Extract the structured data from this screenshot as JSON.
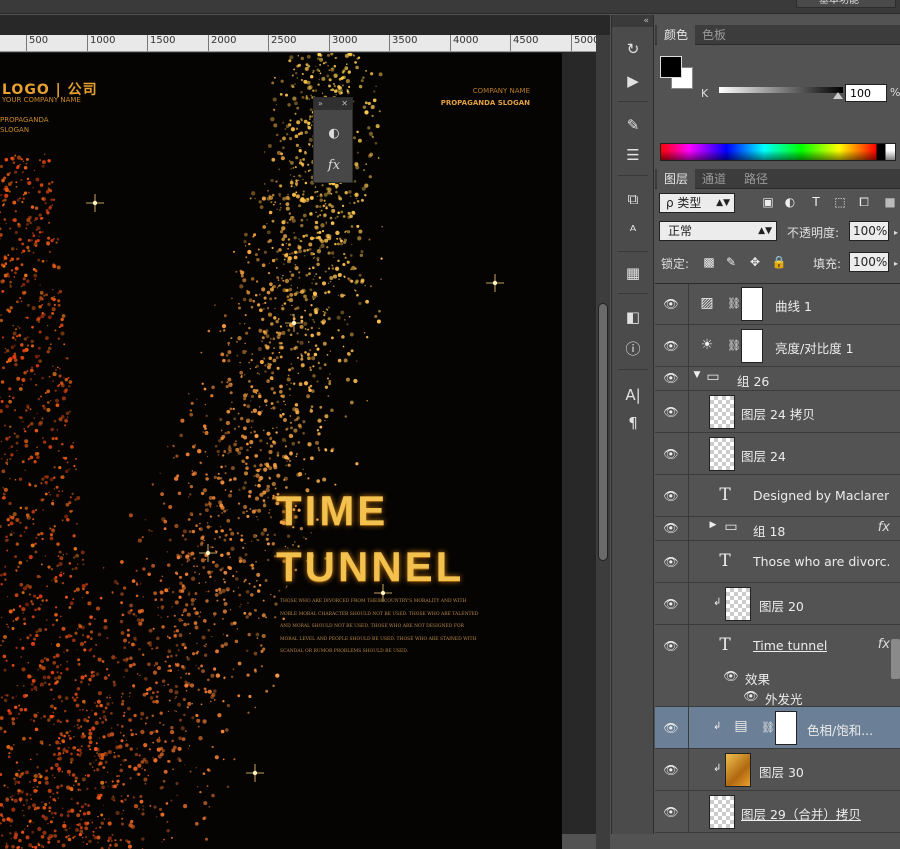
{
  "workspace_menu": "基本功能",
  "ruler": {
    "ticks": [
      "500",
      "1000",
      "1500",
      "2000",
      "2500",
      "3000",
      "3500",
      "4000",
      "4500",
      "5000"
    ]
  },
  "poster": {
    "logo": "LOGO | 公司",
    "logo_sub": "YOUR COMPANY NAME",
    "propaganda": "PROPAGANDA SLOGAN",
    "company_name": "COMPANY NAME",
    "company_slogan": "PROPAGANDA SLOGAN",
    "title_line1": "TIME",
    "title_line2": "TUNNEL",
    "body": "THOSE WHO ARE DIVORCED FROM THEIR COUNTRY'S MORALITY AND WITH NOBLE MORAL CHARACTER SHOULD NOT BE USED. THOSE WHO ARE TALENTED AND MORAL SHOULD NOT BE USED. THOSE WHO ARE NOT DESIGNED FOR MORAL LEVEL AND PEOPLE SHOULD BE USED. THOSE WHO ARE STAINED WITH SCANDAL OR RUMOR PROBLEMS SHOULD BE USED."
  },
  "floating_panel": {
    "collapse": "»",
    "close": "✕",
    "icons": [
      "adjustment-icon",
      "fx-icon"
    ]
  },
  "toolstrip": {
    "collapse": "«",
    "tools": [
      "history-icon",
      "play-icon",
      "brush-preset-icon",
      "adjust-sliders-icon",
      "clone-source-icon",
      "character-style-icon",
      "3d-icon",
      "cube-icon",
      "info-icon",
      "character-icon",
      "paragraph-icon"
    ]
  },
  "color_panel": {
    "tabs": [
      "颜色",
      "色板"
    ],
    "channel": "K",
    "value": "100",
    "unit": "%",
    "foreground": "#000000",
    "background": "#ffffff"
  },
  "layers_panel": {
    "tabs": [
      "图层",
      "通道",
      "路径"
    ],
    "filter_kind": "ρ 类型",
    "blend_mode": "正常",
    "opacity_label": "不透明度:",
    "opacity": "100%",
    "lock_label": "锁定:",
    "fill_label": "填充:",
    "fill": "100%",
    "layers": [
      {
        "name": "曲线 1",
        "type": "adjustment",
        "icon": "curves-icon"
      },
      {
        "name": "亮度/对比度 1",
        "type": "adjustment",
        "icon": "brightness-icon"
      },
      {
        "name": "组 26",
        "type": "group-open"
      },
      {
        "name": "图层 24 拷贝",
        "type": "pixel"
      },
      {
        "name": "图层 24",
        "type": "pixel"
      },
      {
        "name": "Designed by Maclaren...",
        "type": "text"
      },
      {
        "name": "组 18",
        "type": "group-closed",
        "fx": "fx"
      },
      {
        "name": "Those who are divorc...",
        "type": "text"
      },
      {
        "name": "图层 20",
        "type": "pixel-clipped"
      },
      {
        "name": "Time  tunnel",
        "type": "text",
        "fx": "fx"
      },
      {
        "name": "效果",
        "type": "effects"
      },
      {
        "name": "外发光",
        "type": "effect-item"
      },
      {
        "name": "色相/饱和...",
        "type": "adjustment-selected"
      },
      {
        "name": "图层 30",
        "type": "pixel-gold"
      },
      {
        "name": "图层 29（合并）拷贝",
        "type": "pixel"
      }
    ]
  }
}
